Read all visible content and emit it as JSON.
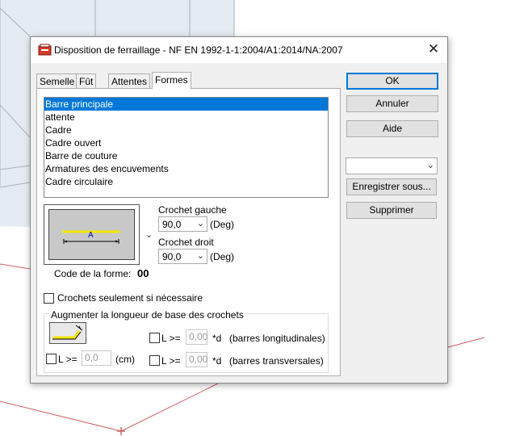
{
  "dialog": {
    "title": "Disposition de ferraillage - NF EN 1992-1-1:2004/A1:2014/NA:2007",
    "close_glyph": "✕"
  },
  "tabs": [
    {
      "label": "Semelle"
    },
    {
      "label": "Fût"
    },
    {
      "label": "Attentes"
    },
    {
      "label": "Formes",
      "active": true
    }
  ],
  "shapes_list": {
    "selected_index": 0,
    "items": [
      "Barre principale",
      "attente",
      "Cadre",
      "Cadre ouvert",
      "Barre de couture",
      "Armatures des encuvements",
      "Cadre circulaire"
    ]
  },
  "shape_preview": {
    "dimension_label": "A",
    "bar_color": "#f2e600"
  },
  "crochet_gauche": {
    "label": "Crochet gauche",
    "value": "90,0",
    "unit": "(Deg)"
  },
  "crochet_droit": {
    "label": "Crochet droit",
    "value": "90,0",
    "unit": "(Deg)"
  },
  "shape_code": {
    "label": "Code de la forme:",
    "value": "00"
  },
  "crochets_if_needed": {
    "label": "Crochets seulement si nécessaire",
    "checked": false
  },
  "hook_length_group": {
    "title": "Augmenter la longueur de base des crochets",
    "longitudinal": {
      "prefix": "L >=",
      "value": "0,00",
      "unit": "*d",
      "description": "(barres longitudinales)",
      "checked": false
    },
    "transversal": {
      "prefix": "L >=",
      "value": "0,00",
      "unit": "*d",
      "description": "(barres transversales)",
      "checked": false
    },
    "length": {
      "prefix": "L >=",
      "value": "0,0",
      "unit": "(cm)",
      "checked": false
    }
  },
  "buttons": {
    "ok": "OK",
    "cancel": "Annuler",
    "help": "Aide",
    "save_as": "Enregistrer sous...",
    "delete": "Supprimer"
  },
  "preset_combo": {
    "value": ""
  },
  "colors": {
    "accent": "#0078d7",
    "selection": "#0078d7",
    "preview_fill": "#c8c8c8",
    "background_lines": "#b0b8c0",
    "background_red_lines": "#d04040"
  }
}
